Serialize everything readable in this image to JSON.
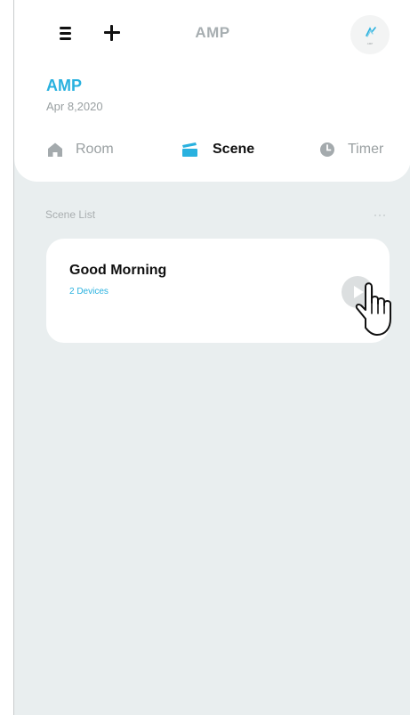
{
  "header": {
    "title": "AMP",
    "avatar_caption": "AMP"
  },
  "home": {
    "name": "AMP",
    "date": "Apr 8,2020"
  },
  "tabs": [
    {
      "label": "Room",
      "icon": "home-icon",
      "active": false
    },
    {
      "label": "Scene",
      "icon": "clapperboard-icon",
      "active": true
    },
    {
      "label": "Timer",
      "icon": "clock-icon",
      "active": false
    }
  ],
  "scene_list": {
    "title": "Scene List",
    "more": "···",
    "items": [
      {
        "name": "Good Morning",
        "devices": "2 Devices"
      }
    ]
  },
  "colors": {
    "accent": "#29b1df",
    "background": "#e9eeef",
    "muted": "#9aa0a2"
  }
}
